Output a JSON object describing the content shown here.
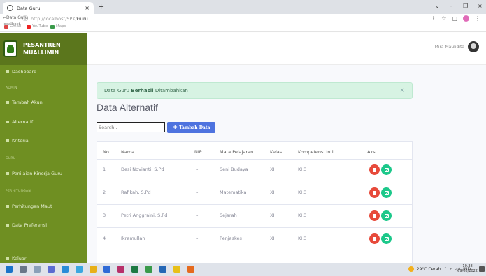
{
  "browser": {
    "tab_title": "Data Guru",
    "url_host": "http://localhost/SPK/",
    "url_path": "Guru",
    "back_hint": "←Data Guru",
    "bookmarks": [
      "Gmail",
      "YouTube",
      "Maps"
    ],
    "bookmark_overlay": "localhost"
  },
  "sidebar": {
    "brand_line1": "PESANTREN",
    "brand_line2": "MUALLIMIN",
    "items": [
      {
        "label": "Dashboard"
      },
      {
        "label": "ADMIN",
        "heading": true
      },
      {
        "label": "Tambah Akun"
      },
      {
        "label": "Alternatif"
      },
      {
        "label": "Kriteria"
      },
      {
        "label": "GURU",
        "heading": true
      },
      {
        "label": "Penilaian Kinerja Guru"
      },
      {
        "label": "PERHITUNGAN",
        "heading": true
      },
      {
        "label": "Perhitungan Maut"
      },
      {
        "label": "Data Preferensi"
      },
      {
        "label": "Keluar"
      }
    ]
  },
  "topbar": {
    "user_name": "Mira Maulidita"
  },
  "alert": {
    "prefix": "Data Guru ",
    "bold": "Berhasil",
    "suffix": " Ditambahkan",
    "close": "×"
  },
  "page": {
    "title": "Data Alternatif",
    "search_placeholder": "Search..",
    "add_button": "Tambah Data"
  },
  "table": {
    "headers": [
      "No",
      "Nama",
      "NIP",
      "Mata Pelajaran",
      "Kelas",
      "Kompetensi Inti",
      "Aksi"
    ],
    "rows": [
      [
        "1",
        "Desi Novianti, S.Pd",
        "-",
        "Seni Budaya",
        "XI",
        "KI 3"
      ],
      [
        "2",
        "Rafikah, S.Pd",
        "-",
        "Matematika",
        "XI",
        "KI 3"
      ],
      [
        "3",
        "Petri Anggraini, S.Pd",
        "-",
        "Sejarah",
        "XI",
        "KI 3"
      ],
      [
        "4",
        "Ikramullah",
        "-",
        "Penjaskes",
        "XI",
        "KI 3"
      ]
    ]
  },
  "taskbar": {
    "weather": "29°C Cerah",
    "lang": "IND",
    "time": "10.38",
    "date": "09/08/2022"
  },
  "colors": {
    "sidebar": "#6f8f22",
    "primary": "#4e73df",
    "danger": "#e74a3b",
    "success": "#1cc88a",
    "alert_bg": "#d7f3e3"
  }
}
